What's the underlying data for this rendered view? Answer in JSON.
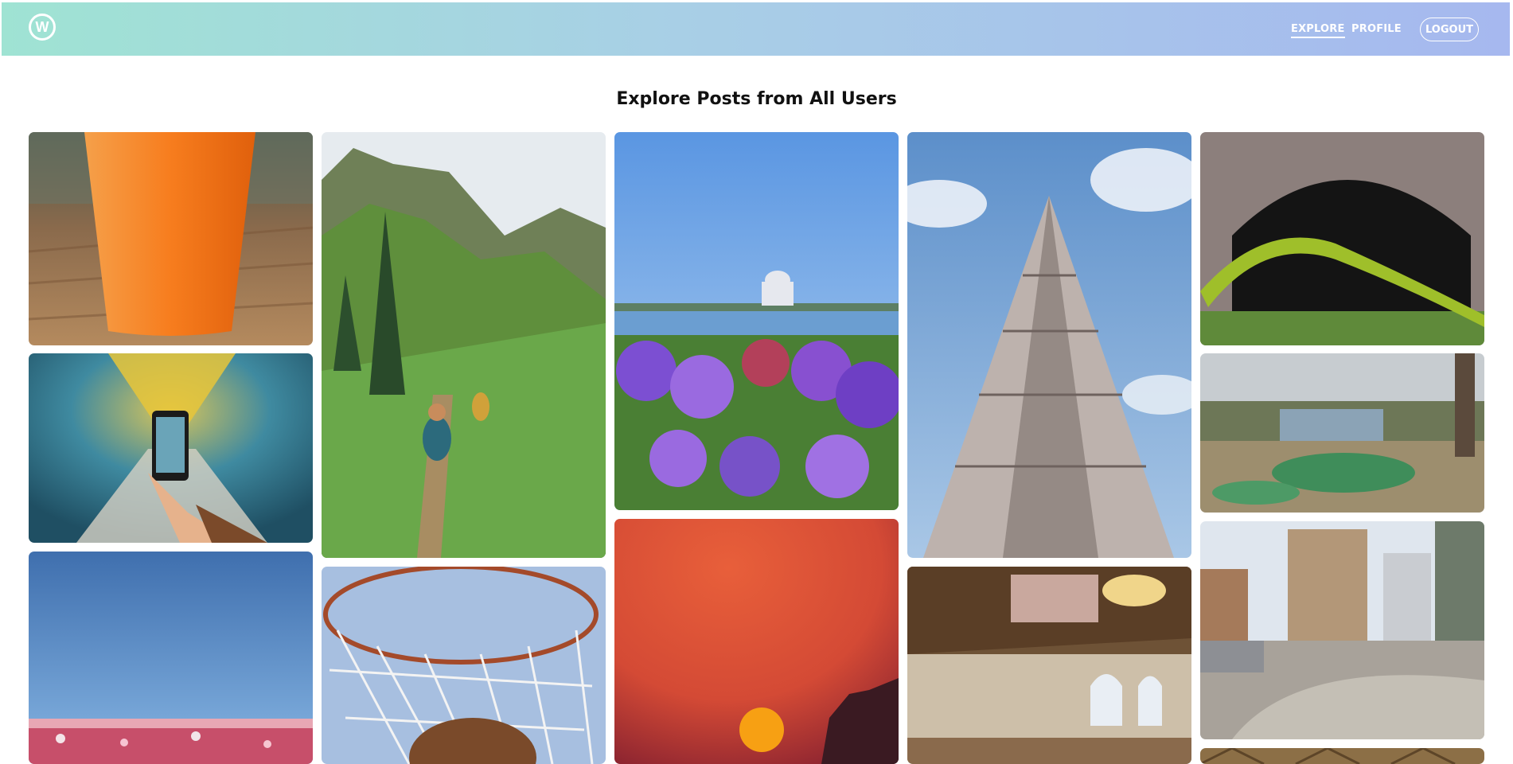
{
  "app": {
    "logo_letter": "W"
  },
  "nav": {
    "explore_label": "EXPLORE",
    "profile_label": "PROFILE",
    "logout_label": "LOGOUT"
  },
  "main": {
    "title": "Explore Posts from All Users"
  },
  "colors": {
    "nav_gradient_start": "#9fe3d3",
    "nav_gradient_end": "#a6b8ef",
    "nav_text": "#ffffff"
  },
  "posts": [
    {
      "subject": "orange drink cup on wooden table"
    },
    {
      "subject": "phone held up in yellow tunnel"
    },
    {
      "subject": "flower field under blue sky"
    },
    {
      "subject": "hikers on green mountain trail"
    },
    {
      "subject": "basketball hoop net"
    },
    {
      "subject": "purple flowers by a lake with domed building"
    },
    {
      "subject": "orange sunset sky"
    },
    {
      "subject": "flatiron building looking up"
    },
    {
      "subject": "library reading room ceiling"
    },
    {
      "subject": "mossy branch in stone tunnel"
    },
    {
      "subject": "abandoned mini golf course"
    },
    {
      "subject": "city street corner with buildings"
    }
  ]
}
